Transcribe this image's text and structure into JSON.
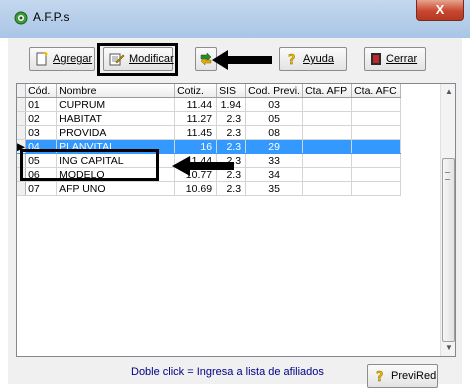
{
  "window": {
    "title": "A.F.P.s",
    "close_label": "X"
  },
  "toolbar": {
    "agregar": "Agregar",
    "modificar": "Modificar",
    "ayuda": "Ayuda",
    "cerrar": "Cerrar"
  },
  "grid": {
    "columns": [
      "Cód.",
      "Nombre",
      "Cotiz.",
      "SIS",
      "Cod. Previ.",
      "Cta. AFP",
      "Cta. AFC"
    ],
    "rows": [
      {
        "cod": "01",
        "nombre": "CUPRUM",
        "cotiz": "11.44",
        "sis": "1.94",
        "previ": "03",
        "cta_afp": "",
        "cta_afc": ""
      },
      {
        "cod": "02",
        "nombre": "HABITAT",
        "cotiz": "11.27",
        "sis": "2.3",
        "previ": "05",
        "cta_afp": "",
        "cta_afc": ""
      },
      {
        "cod": "03",
        "nombre": "PROVIDA",
        "cotiz": "11.45",
        "sis": "2.3",
        "previ": "08",
        "cta_afp": "",
        "cta_afc": ""
      },
      {
        "cod": "04",
        "nombre": "PLANVITAL",
        "cotiz": "16",
        "sis": "2.3",
        "previ": "29",
        "cta_afp": "",
        "cta_afc": ""
      },
      {
        "cod": "05",
        "nombre": "ING CAPITAL",
        "cotiz": "11.44",
        "sis": "2.3",
        "previ": "33",
        "cta_afp": "",
        "cta_afc": ""
      },
      {
        "cod": "06",
        "nombre": "MODELO",
        "cotiz": "10.77",
        "sis": "2.3",
        "previ": "34",
        "cta_afp": "",
        "cta_afc": ""
      },
      {
        "cod": "07",
        "nombre": "AFP UNO",
        "cotiz": "10.69",
        "sis": "2.3",
        "previ": "35",
        "cta_afp": "",
        "cta_afc": ""
      }
    ],
    "selected_row": 3
  },
  "footer": {
    "hint": "Doble click = Ingresa a lista de afiliados",
    "previred": "PreviRed"
  },
  "colors": {
    "selection": "#3399ff",
    "hint_text": "#00008b",
    "close_button": "#c9462f"
  },
  "icons": [
    "afp-app-icon",
    "add-document-icon",
    "edit-document-icon",
    "help-question-icon",
    "close-door-icon",
    "refresh-icon",
    "arrow-pointer-annotation"
  ]
}
